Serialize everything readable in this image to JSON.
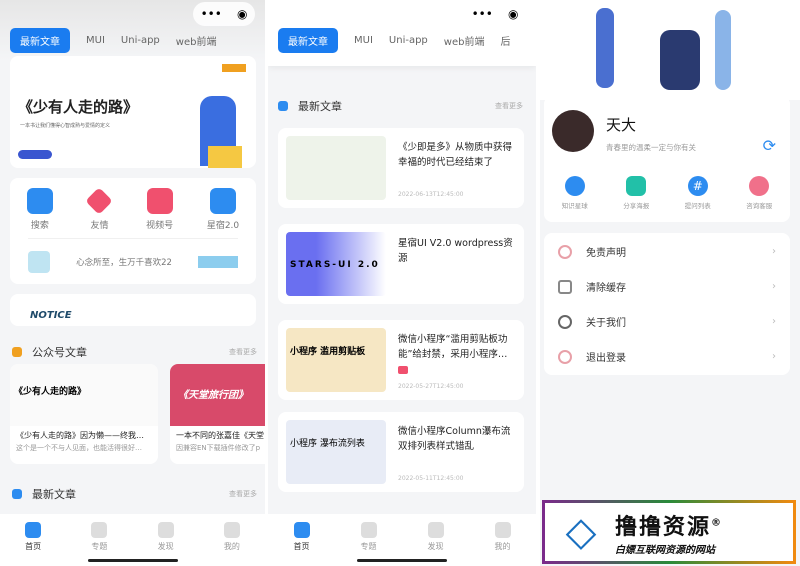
{
  "tabs": [
    "最新文章",
    "MUI",
    "Uni-app",
    "web前端",
    "后"
  ],
  "p1": {
    "banner": {
      "title": "《少有人走的路》",
      "subtitle": "一本书让我们懂得心智成熟与爱情的定义"
    },
    "quick": [
      {
        "label": "搜索",
        "color": "#2d8cf0"
      },
      {
        "label": "友情",
        "color": "#f0506e"
      },
      {
        "label": "视频号",
        "color": "#f0506e"
      },
      {
        "label": "星宿2.0",
        "color": "#2d8cf0"
      }
    ],
    "slogan": "心念所至，生万千喜欢22",
    "notice": "NOTICE",
    "gzh_section": {
      "title": "公众号文章",
      "more": "查看更多"
    },
    "gzh_cards": [
      {
        "banner": "《少有人走的路》",
        "title": "《少有人走的路》因为懒——终我…",
        "desc": "这个是一个不与人见面，也能活得很好…"
      },
      {
        "banner": "《天堂旅行团》",
        "title": "一本不同的张嘉佳《天堂",
        "desc": "因兼容EN下载插件修改了p"
      }
    ],
    "latest_section": {
      "title": "最新文章",
      "more": "查看更多"
    }
  },
  "p2": {
    "latest_section": {
      "title": "最新文章",
      "more": "查看更多"
    },
    "articles": [
      {
        "title": "《少即是多》从物质中获得幸福的时代已经结束了",
        "date": "2022-06-13T12:45:00",
        "thumb_color": "#eef3ea"
      },
      {
        "title": "星宿UI V2.0 wordpress资源",
        "date": "",
        "thumb_color": "#6a6ff0",
        "thumb_text": "STARS-UI 2.0"
      },
      {
        "title": "微信小程序“滥用剪贴板功能”给封禁，采用小程序…",
        "date": "2022-05-27T12:45:00",
        "thumb_color": "#f6e7c4",
        "thumb_text": "小程序 滥用剪贴板"
      },
      {
        "title": "微信小程序Column瀑布流双排列表样式错乱",
        "date": "2022-05-11T12:45:00",
        "thumb_color": "#e8ecf6",
        "thumb_text": "小程序 瀑布流列表"
      }
    ]
  },
  "p3": {
    "user": {
      "name": "天大",
      "bio": "青春里的温柔一定与你有关"
    },
    "actions": [
      {
        "label": "知识星球",
        "color": "#2d8cf0"
      },
      {
        "label": "分享海报",
        "color": "#22c0a8"
      },
      {
        "label": "提问列表",
        "color": "#2d8cf0"
      },
      {
        "label": "咨询客服",
        "color": "#f0708a"
      }
    ],
    "menu": [
      "免责声明",
      "清除缓存",
      "关于我们",
      "退出登录"
    ],
    "watermark": {
      "title": "撸撸资源",
      "subtitle": "白嫖互联网资源的网站",
      "mark": "®"
    }
  },
  "nav": [
    "首页",
    "专题",
    "发现",
    "我的"
  ]
}
